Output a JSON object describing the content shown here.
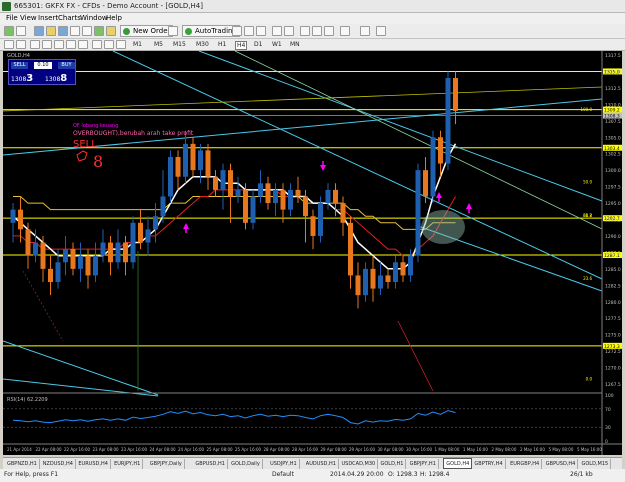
{
  "window": {
    "title": "665301: GKFX FX - CFDs - Demo Account - [GOLD,H4]"
  },
  "menu": [
    "File",
    "View",
    "Insert",
    "Charts",
    "Window",
    "Help"
  ],
  "toolbar": {
    "new_order": "New Order",
    "autotrading": "AutoTrading"
  },
  "timeframes": [
    "M1",
    "M5",
    "M15",
    "M30",
    "H1",
    "H4",
    "D1",
    "W1",
    "MN"
  ],
  "chart": {
    "symbol_label": "GOLD,H4",
    "trade_panel": {
      "sell_label": "SELL",
      "buy_label": "BUY",
      "lot": "0.10",
      "bid_prefix": "1308",
      "bid_big": "3",
      "ask_prefix": "1308",
      "ask_big": "8"
    },
    "annotations": {
      "line1": "OF lobang keuang",
      "line2": "OVERBOUGHT),berubah arah take profit",
      "sell": "SELL",
      "eight": "8"
    },
    "indicator_label": "RSI(14) 62.2209",
    "fib_labels": [
      "100.0",
      "61.8",
      "50.0",
      "38.2",
      "23.6",
      "0.0"
    ],
    "price_axis": [
      "1317.5",
      "1315.0",
      "1312.5",
      "1310.0",
      "1307.5",
      "1305.0",
      "1302.5",
      "1300.0",
      "1297.5",
      "1295.0",
      "1292.5",
      "1290.0",
      "1287.5",
      "1285.0",
      "1282.5",
      "1280.0",
      "1277.5",
      "1275.0",
      "1272.5",
      "1270.0",
      "1267.5"
    ],
    "price_tags": [
      {
        "text": "1315.0",
        "color": "#ffff00"
      },
      {
        "text": "1309.2",
        "color": "#ffff00"
      },
      {
        "text": "1308.3",
        "color": "#c0c0c0"
      },
      {
        "text": "1303.4",
        "color": "#ffff00"
      },
      {
        "text": "1292.7",
        "color": "#ffff00"
      },
      {
        "text": "1287.1",
        "color": "#ffff00"
      },
      {
        "text": "1273.3",
        "color": "#ffff00"
      }
    ],
    "rsi_axis": [
      "100",
      "70",
      "30",
      "0"
    ],
    "time_axis": [
      "21 Apr 2014",
      "22 Apr 08:00",
      "22 Apr 16:00",
      "23 Apr 08:00",
      "23 Apr 16:00",
      "24 Apr 08:00",
      "24 Apr 16:00",
      "25 Apr 08:00",
      "25 Apr 16:00",
      "28 Apr 08:00",
      "28 Apr 16:00",
      "29 Apr 08:00",
      "29 Apr 16:00",
      "30 Apr 08:00",
      "30 Apr 16:00",
      "1 May 08:00",
      "1 May 16:00",
      "2 May 08:00",
      "2 May 16:00",
      "5 May 08:00",
      "5 May 16:00"
    ]
  },
  "sheet_tabs": [
    "GBPNZD,H1",
    "NZDUSD,H4",
    "EURUSD,H4",
    "EURJPY,H1",
    "GBPJPY,Daily",
    "GBPUSD,H1",
    "GOLD,Daily",
    "USDJPY,H1",
    "AUDUSD,H1",
    "USDCAD,M30",
    "GOLD,H1",
    "GBPJPY,H1",
    "GOLD,H4",
    "GBPTRY,H4",
    "EURGBP,H4",
    "GBPUSD,H4",
    "GOLD,M15"
  ],
  "active_tab": "GOLD,H4",
  "status": {
    "help": "For Help, press F1",
    "profile": "Default",
    "datetime": "2014.04.29 20:00",
    "o": "O: 1298.3",
    "h": "H: 1298.4",
    "conn": "26/1 kb"
  },
  "colors": {
    "chart_bg": "#000000",
    "bull": "#1f5fb0",
    "bear": "#e8771e",
    "level": "#ffff00",
    "trend": "#4ac8e8",
    "ma_white": "#ffffff",
    "ma_red": "#e02020",
    "ma_yellow": "#e8c030",
    "annotation": "#ff00ff"
  }
}
